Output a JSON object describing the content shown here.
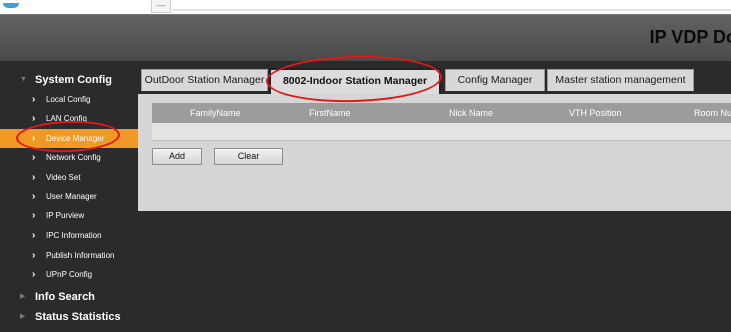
{
  "header": {
    "title": "IP VDP Do"
  },
  "top_strip": {
    "mini_button": "—"
  },
  "sidebar": {
    "sections": [
      {
        "label": "System Config",
        "icon": "triangle-down-icon"
      },
      {
        "label": "Info Search",
        "icon": "triangle-right-icon"
      },
      {
        "label": "Status Statistics",
        "icon": "triangle-right-icon"
      }
    ],
    "chevron": "›",
    "items": [
      {
        "label": "Local Config"
      },
      {
        "label": "LAN Config"
      },
      {
        "label": "Device Manager",
        "active": true
      },
      {
        "label": "Network Config"
      },
      {
        "label": "Video Set"
      },
      {
        "label": "User Manager"
      },
      {
        "label": "IP Purview"
      },
      {
        "label": "IPC Information"
      },
      {
        "label": "Publish Information"
      },
      {
        "label": "UPnP Config"
      }
    ]
  },
  "tabs": [
    {
      "label": "OutDoor Station Manager"
    },
    {
      "label": "8002-Indoor Station Manager",
      "active": true
    },
    {
      "label": "Config Manager"
    },
    {
      "label": "Master station management"
    }
  ],
  "table": {
    "columns": [
      "FamilyName",
      "FirstName",
      "Nick Name",
      "VTH Position",
      "Room Nu"
    ],
    "rows": []
  },
  "buttons": {
    "add": "Add",
    "clear": "Clear"
  },
  "colors": {
    "header_bg": "#555555",
    "sidebar_bg": "#2b2b2b",
    "active_item": "#f09a23",
    "annotation_red": "#e01818",
    "table_header": "#9c9c9c"
  }
}
